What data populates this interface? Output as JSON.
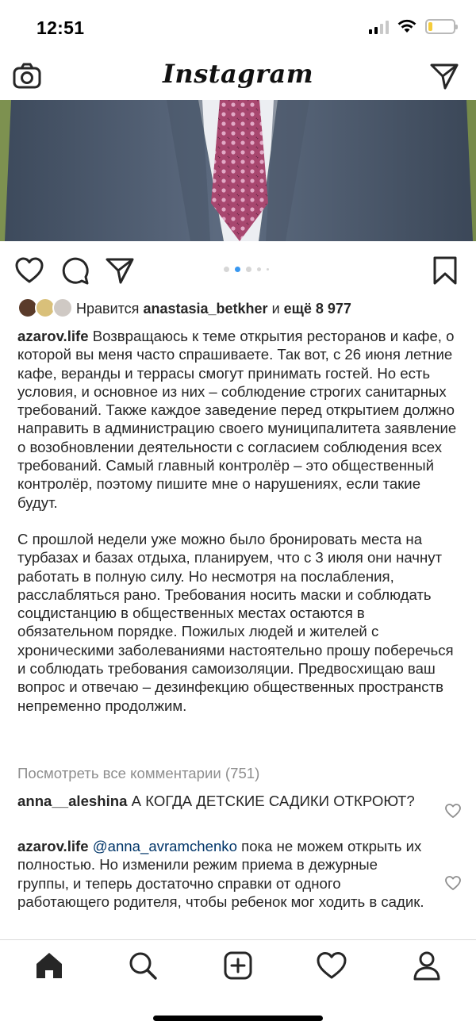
{
  "status_bar": {
    "time": "12:51",
    "icons": [
      "cellular-signal-icon",
      "wifi-icon",
      "battery-icon"
    ],
    "battery_level": 0.15,
    "battery_color": "#f5cc3b"
  },
  "nav": {
    "logo": "Instagram",
    "left_icon": "camera-icon",
    "right_icon": "direct-message-icon"
  },
  "post": {
    "carousel": {
      "count": 5,
      "active_index": 1
    },
    "likes": {
      "prefix": "Нравится",
      "user": "anastasia_betkher",
      "conjunction": "и",
      "others": "ещё 8 977"
    },
    "caption": {
      "username": "azarov.life",
      "paragraph1": "Возвращаюсь к теме открытия ресторанов и кафе, о которой вы меня часто спрашиваете. Так вот, с 26 июня летние кафе, веранды и террасы смогут принимать гостей. Но есть условия, и основное из них – соблюдение строгих санитарных требований. Также каждое заведение перед открытием должно направить в администрацию своего муниципалитета заявление о возобновлении деятельности с согласием соблюдения всех требований. Самый главный контролёр – это общественный контролёр, поэтому пишите мне о нарушениях, если такие будут.",
      "paragraph2": "С прошлой недели уже можно было бронировать места на турбазах и базах отдыха, планируем, что с 3 июля они начнут работать в полную силу. Но несмотря на послабления, расслабляться рано. Требования носить маски и соблюдать соцдистанцию в общественных местах остаются в обязательном порядке. Пожилых людей и жителей с хроническими заболеваниями настоятельно прошу поберечься и соблюдать требования самоизоляции. Предвосхищаю ваш вопрос и отвечаю – дезинфекцию общественных пространств непременно продолжим."
    },
    "view_comments": "Посмотреть все комментарии (751)",
    "comments": [
      {
        "username": "anna__aleshina",
        "text": "А КОГДА ДЕТСКИЕ САДИКИ ОТКРОЮТ?"
      },
      {
        "username": "azarov.life",
        "mention": "@anna_avramchenko",
        "text": "пока не можем открыть их полностью. Но изменили режим приема в дежурные группы, и теперь достаточно справки от одного работающего родителя, чтобы ребенок мог ходить в садик."
      }
    ]
  },
  "tab_bar": {
    "tabs": [
      "home-icon",
      "search-icon",
      "new-post-icon",
      "activity-icon",
      "profile-icon"
    ]
  },
  "colors": {
    "link_blue": "#3897f0",
    "mention": "#003569",
    "secondary_text": "#8e8e8e"
  }
}
